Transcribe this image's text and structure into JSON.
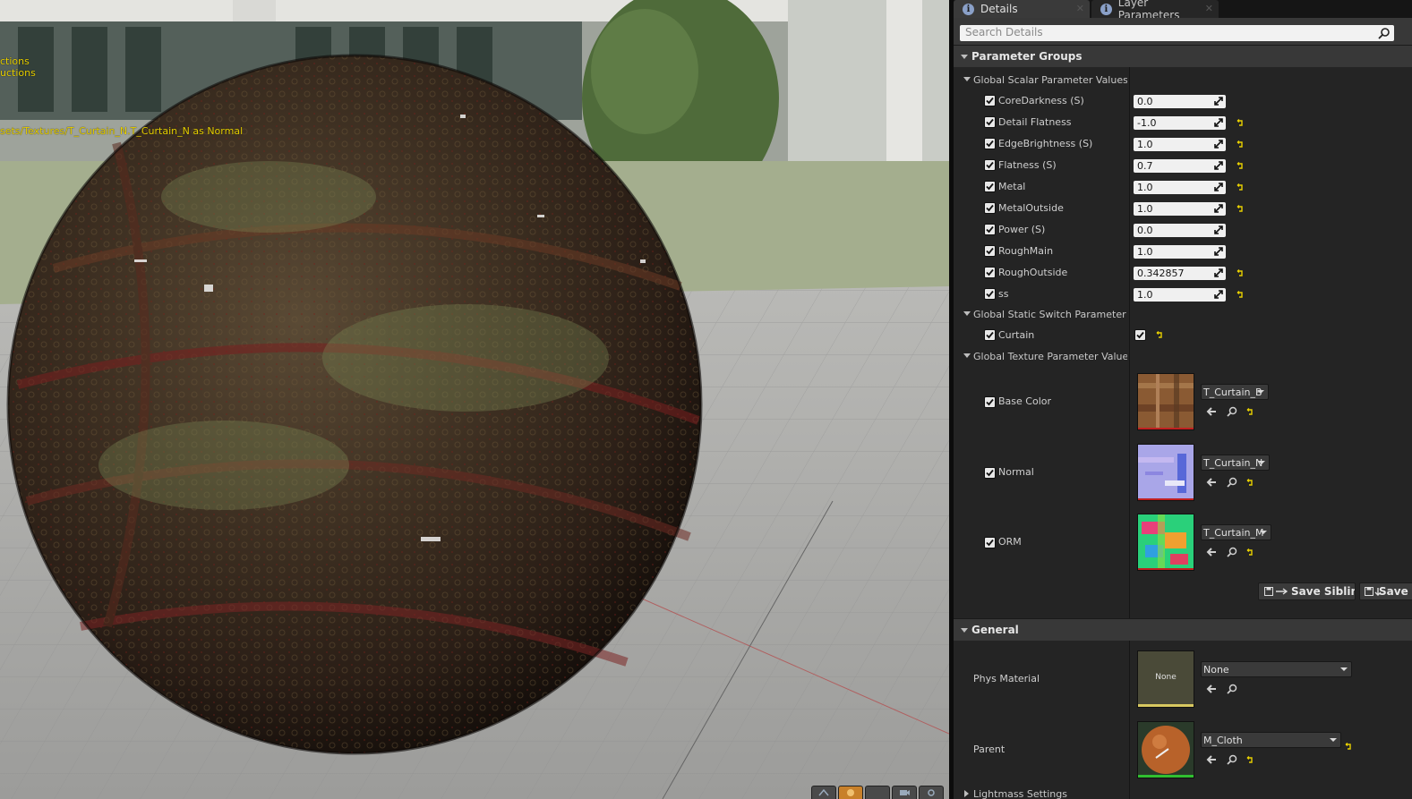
{
  "viewport": {
    "messages": [
      "ctions",
      "uctions",
      "sets/Textures/T_Curtain_N.T_Curtain_N as Normal"
    ],
    "toolbar_icons": [
      "view-mode-icon",
      "material-sphere-icon",
      "blank-icon",
      "camera-icon",
      "settings-icon"
    ]
  },
  "tabs": [
    {
      "label": "Details",
      "icon": "info-icon"
    },
    {
      "label": "Layer Parameters",
      "icon": "info-icon"
    }
  ],
  "search": {
    "placeholder": "Search Details",
    "value": ""
  },
  "parameter_groups": {
    "title": "Parameter Groups",
    "scalar_group": {
      "title": "Global Scalar Parameter Values",
      "params": [
        {
          "name": "CoreDarkness (S)",
          "value": "0.0",
          "checked": true,
          "modified": false
        },
        {
          "name": "Detail Flatness",
          "value": "-1.0",
          "checked": true,
          "modified": true
        },
        {
          "name": "EdgeBrightness (S)",
          "value": "1.0",
          "checked": true,
          "modified": true
        },
        {
          "name": "Flatness (S)",
          "value": "0.7",
          "checked": true,
          "modified": true
        },
        {
          "name": "Metal",
          "value": "1.0",
          "checked": true,
          "modified": true
        },
        {
          "name": "MetalOutside",
          "value": "1.0",
          "checked": true,
          "modified": true
        },
        {
          "name": "Power (S)",
          "value": "0.0",
          "checked": true,
          "modified": false
        },
        {
          "name": "RoughMain",
          "value": "1.0",
          "checked": true,
          "modified": false
        },
        {
          "name": "RoughOutside",
          "value": "0.342857",
          "checked": true,
          "modified": true
        },
        {
          "name": "ss",
          "value": "1.0",
          "checked": true,
          "modified": true
        }
      ]
    },
    "switch_group": {
      "title": "Global Static Switch Parameter Va",
      "params": [
        {
          "name": "Curtain",
          "checked": true,
          "value_checked": true,
          "modified": true
        }
      ]
    },
    "texture_group": {
      "title": "Global Texture Parameter Values",
      "params": [
        {
          "name": "Base Color",
          "asset": "T_Curtain_B",
          "checked": true
        },
        {
          "name": "Normal",
          "asset": "T_Curtain_N",
          "checked": true
        },
        {
          "name": "ORM",
          "asset": "T_Curtain_M",
          "checked": true
        }
      ]
    },
    "buttons": {
      "save_sibling": "Save Sibling",
      "save_child": "Save Child"
    }
  },
  "general": {
    "title": "General",
    "phys_material": {
      "label": "Phys Material",
      "thumb_text": "None",
      "value": "None"
    },
    "parent": {
      "label": "Parent",
      "value": "M_Cloth"
    }
  },
  "lightmass": {
    "title": "Lightmass Settings"
  },
  "colors": {
    "accent_orange": "#c8802a",
    "reset_yellow": "#e8d000",
    "warning_text": "#e8d000"
  }
}
